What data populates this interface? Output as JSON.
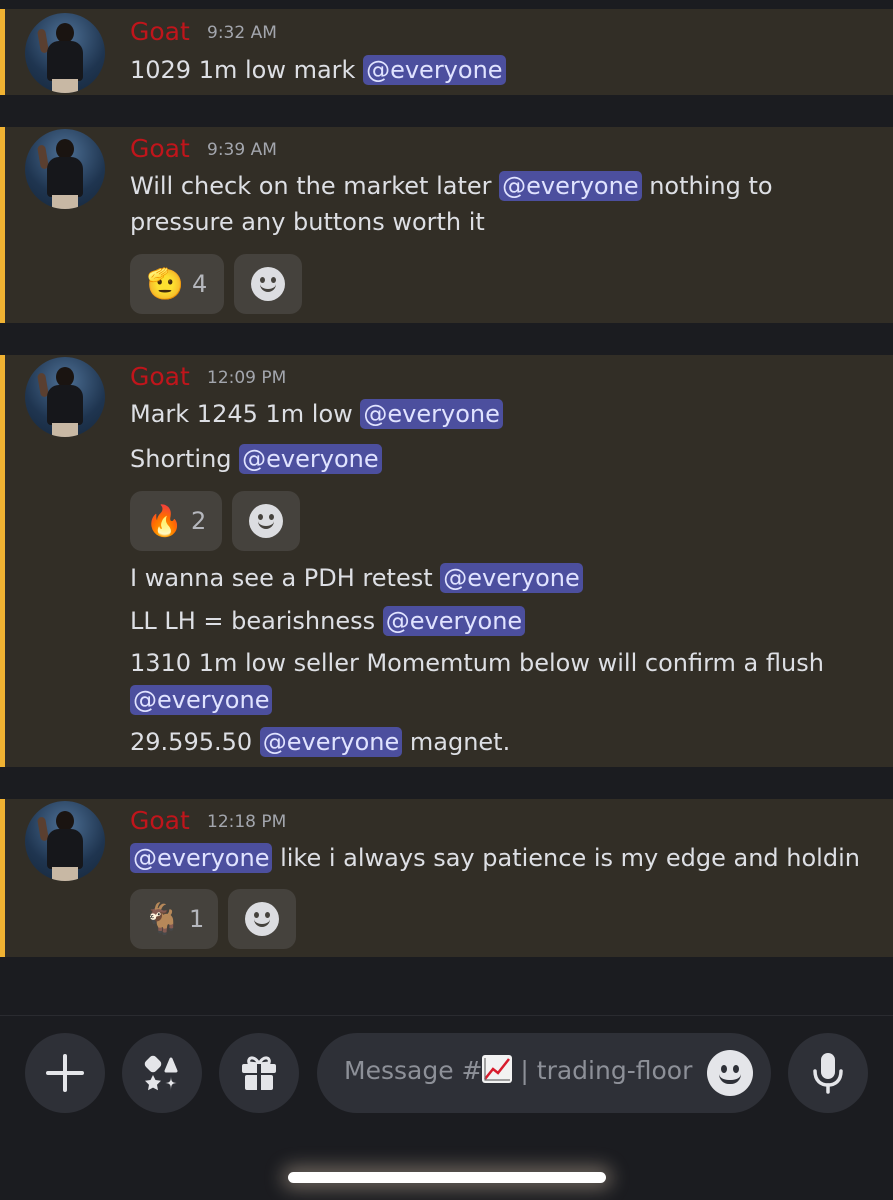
{
  "messages": [
    {
      "author": "Goat",
      "time": "9:32 AM",
      "lines": [
        {
          "text": "1029 1m low mark ",
          "mention": "@everyone",
          "after": ""
        }
      ]
    },
    {
      "author": "Goat",
      "time": "9:39 AM",
      "lines": [
        {
          "text": "Will check on the market later ",
          "mention": "@everyone",
          "after": "  nothing to"
        },
        {
          "text": "pressure any buttons worth it",
          "mention": "",
          "after": ""
        }
      ],
      "reactions": [
        {
          "emoji": "🫡",
          "count": "4"
        }
      ]
    },
    {
      "author": "Goat",
      "time": "12:09 PM",
      "lines": [
        {
          "text": "Mark 1245 1m low ",
          "mention": "@everyone",
          "after": ""
        },
        {
          "text": "Shorting ",
          "mention": "@everyone",
          "after": ""
        },
        {
          "text": "I wanna see a PDH retest ",
          "mention": "@everyone",
          "after": ""
        },
        {
          "text": "LL LH = bearishness ",
          "mention": "@everyone",
          "after": ""
        },
        {
          "text": "1310 1m low seller Momemtum below will confirm a flush",
          "mention": "",
          "after": ""
        },
        {
          "text": "",
          "mention": "@everyone",
          "after": ""
        },
        {
          "text": "29.595.50 ",
          "mention": "@everyone",
          "after": "  magnet."
        }
      ],
      "reactions": [
        {
          "emoji": "🔥",
          "count": "2"
        }
      ]
    },
    {
      "author": "Goat",
      "time": "12:18 PM",
      "lines": [
        {
          "text": "",
          "mention": "@everyone",
          "after": " like i always say patience is my edge and holdin"
        }
      ],
      "reactions": [
        {
          "emoji": "🐐",
          "count": "1"
        }
      ]
    }
  ],
  "composer": {
    "placeholder_prefix": "Message #",
    "placeholder_suffix": " | trading-floor",
    "channel_emoji": "chart-increasing-icon"
  },
  "icons": {
    "add": "plus-icon",
    "apps": "apps-icon",
    "gift": "gift-icon",
    "emoji": "smiley-icon",
    "mic": "microphone-icon"
  },
  "colors": {
    "accent_bar": "#f0b232",
    "author": "#c0151b",
    "mention_bg": "#4c4f9e",
    "highlight_bg": "#322e26"
  }
}
